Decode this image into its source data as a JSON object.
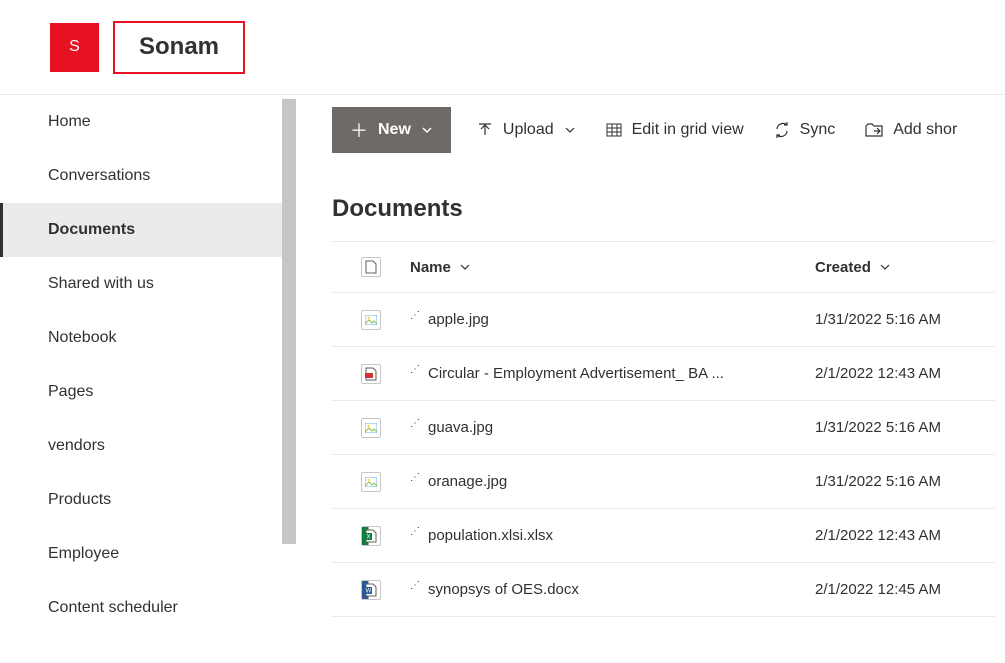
{
  "header": {
    "avatar_initial": "S",
    "site_title": "Sonam"
  },
  "sidebar": {
    "items": [
      {
        "label": "Home"
      },
      {
        "label": "Conversations"
      },
      {
        "label": "Documents",
        "active": true
      },
      {
        "label": "Shared with us"
      },
      {
        "label": "Notebook"
      },
      {
        "label": "Pages"
      },
      {
        "label": "vendors"
      },
      {
        "label": "Products"
      },
      {
        "label": "Employee"
      },
      {
        "label": "Content scheduler"
      }
    ]
  },
  "toolbar": {
    "new_label": "New",
    "upload_label": "Upload",
    "edit_grid_label": "Edit in grid view",
    "sync_label": "Sync",
    "add_shortcut_label": "Add shor"
  },
  "page": {
    "title": "Documents"
  },
  "columns": {
    "name": "Name",
    "created": "Created"
  },
  "files": [
    {
      "name": "apple.jpg",
      "created": "1/31/2022 5:16 AM",
      "type": "img"
    },
    {
      "name": "Circular - Employment Advertisement_ BA ...",
      "created": "2/1/2022 12:43 AM",
      "type": "pdf"
    },
    {
      "name": "guava.jpg",
      "created": "1/31/2022 5:16 AM",
      "type": "img"
    },
    {
      "name": "oranage.jpg",
      "created": "1/31/2022 5:16 AM",
      "type": "img"
    },
    {
      "name": "population.xlsi.xlsx",
      "created": "2/1/2022 12:43 AM",
      "type": "xls"
    },
    {
      "name": "synopsys of OES.docx",
      "created": "2/1/2022 12:45 AM",
      "type": "doc"
    }
  ]
}
